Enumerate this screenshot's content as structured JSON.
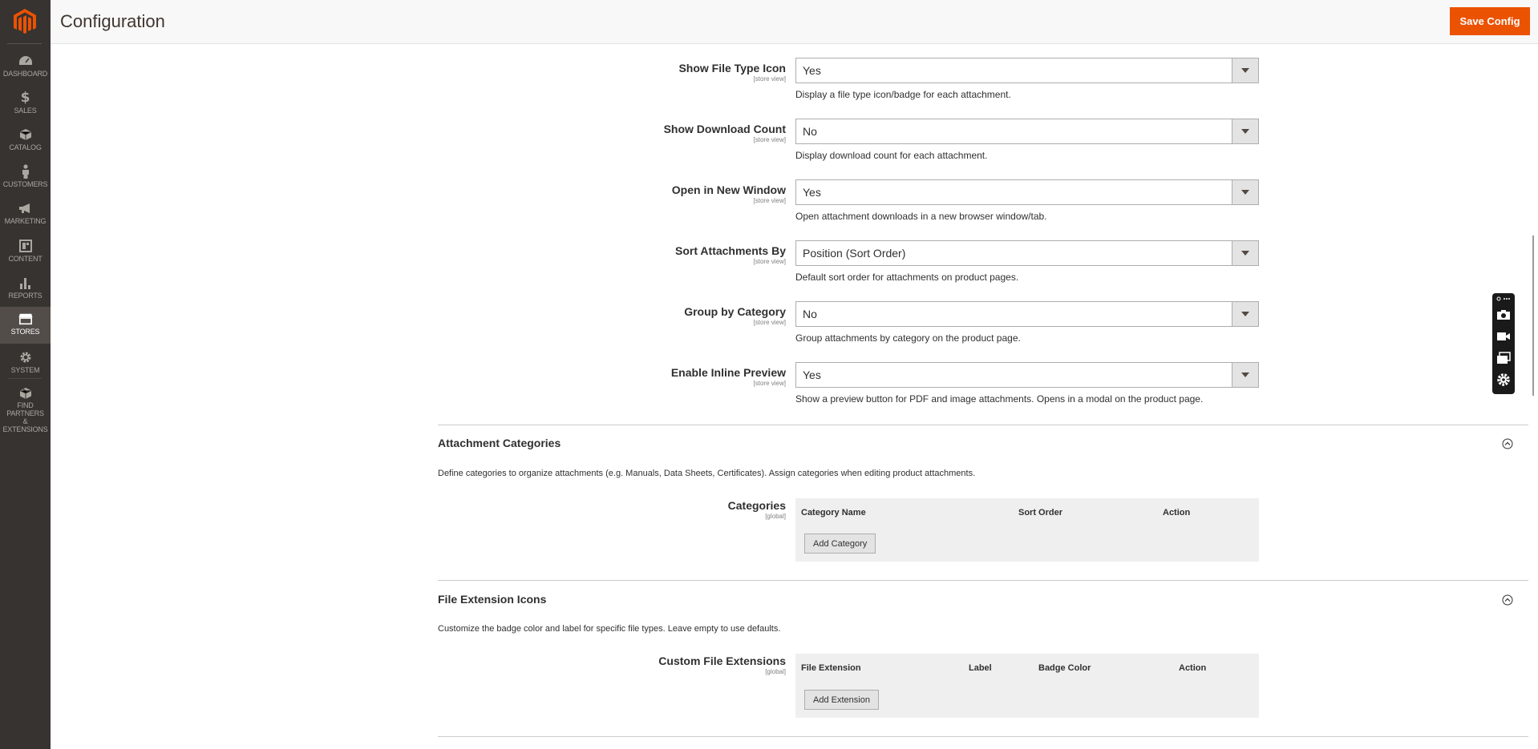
{
  "header": {
    "title": "Configuration",
    "save_label": "Save Config"
  },
  "sidebar": {
    "items": [
      {
        "label": "DASHBOARD",
        "icon": "dashboard-icon"
      },
      {
        "label": "SALES",
        "icon": "dollar-icon"
      },
      {
        "label": "CATALOG",
        "icon": "cube-icon"
      },
      {
        "label": "CUSTOMERS",
        "icon": "person-icon"
      },
      {
        "label": "MARKETING",
        "icon": "megaphone-icon"
      },
      {
        "label": "CONTENT",
        "icon": "layout-icon"
      },
      {
        "label": "REPORTS",
        "icon": "bar-chart-icon"
      },
      {
        "label": "STORES",
        "icon": "storefront-icon",
        "active": true
      },
      {
        "label": "SYSTEM",
        "icon": "gear-icon"
      },
      {
        "label": "FIND PARTNERS",
        "label2": "& EXTENSIONS",
        "icon": "box-icon"
      }
    ]
  },
  "fields": [
    {
      "label": "Show File Type Icon",
      "scope": "[store view]",
      "value": "Yes",
      "note": "Display a file type icon/badge for each attachment."
    },
    {
      "label": "Show Download Count",
      "scope": "[store view]",
      "value": "No",
      "note": "Display download count for each attachment."
    },
    {
      "label": "Open in New Window",
      "scope": "[store view]",
      "value": "Yes",
      "note": "Open attachment downloads in a new browser window/tab."
    },
    {
      "label": "Sort Attachments By",
      "scope": "[store view]",
      "value": "Position (Sort Order)",
      "note": "Default sort order for attachments on product pages."
    },
    {
      "label": "Group by Category",
      "scope": "[store view]",
      "value": "No",
      "note": "Group attachments by category on the product page."
    },
    {
      "label": "Enable Inline Preview",
      "scope": "[store view]",
      "value": "Yes",
      "note": "Show a preview button for PDF and image attachments. Opens in a modal on the product page."
    }
  ],
  "sections": {
    "categories": {
      "title": "Attachment Categories",
      "desc": "Define categories to organize attachments (e.g. Manuals, Data Sheets, Certificates). Assign categories when editing product attachments.",
      "field_label": "Categories",
      "scope": "[global]",
      "columns": [
        "Category Name",
        "Sort Order",
        "Action"
      ],
      "button": "Add Category"
    },
    "extensions": {
      "title": "File Extension Icons",
      "desc": "Customize the badge color and label for specific file types. Leave empty to use defaults.",
      "field_label": "Custom File Extensions",
      "scope": "[global]",
      "columns": [
        "File Extension",
        "Label",
        "Badge Color",
        "Action"
      ],
      "button": "Add Extension"
    }
  },
  "colors": {
    "accent": "#eb5202",
    "sidebar": "#373330"
  }
}
